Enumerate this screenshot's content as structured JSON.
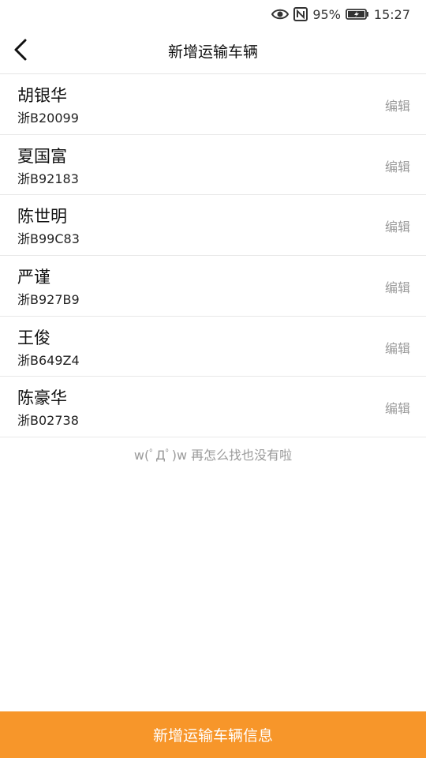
{
  "status_bar": {
    "icons": [
      "eye-icon",
      "nfc-icon",
      "battery-icon"
    ],
    "battery_percent": "95%",
    "time": "15:27"
  },
  "header": {
    "back_icon": "back-arrow-icon",
    "title": "新增运输车辆"
  },
  "vehicles": [
    {
      "name": "胡银华",
      "plate": "浙B20099",
      "action": "编辑"
    },
    {
      "name": "夏国富",
      "plate": "浙B92183",
      "action": "编辑"
    },
    {
      "name": "陈世明",
      "plate": "浙B99C83",
      "action": "编辑"
    },
    {
      "name": "严谨",
      "plate": "浙B927B9",
      "action": "编辑"
    },
    {
      "name": "王俊",
      "plate": "浙B649Z4",
      "action": "编辑"
    },
    {
      "name": "陈豪华",
      "plate": "浙B02738",
      "action": "编辑"
    }
  ],
  "list_end_text": "w(ﾟДﾟ)w 再怎么找也没有啦",
  "bottom_button": {
    "label": "新增运输车辆信息",
    "color": "#F7962A"
  }
}
